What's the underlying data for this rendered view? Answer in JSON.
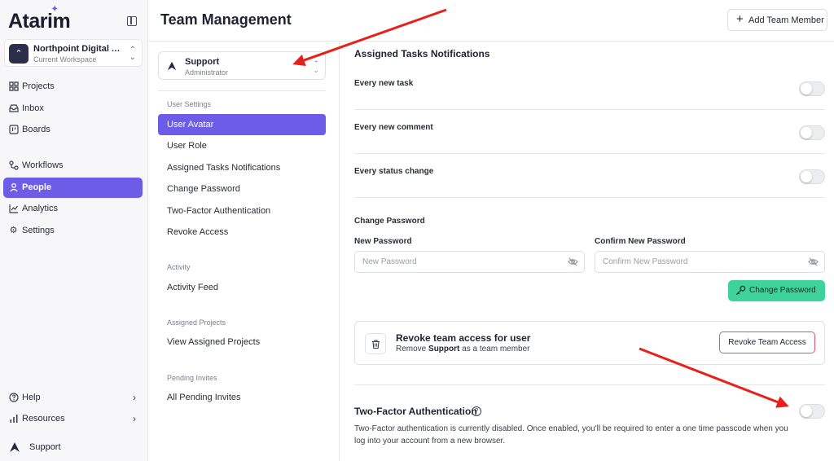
{
  "brand": {
    "name": "Atarim"
  },
  "workspace": {
    "name": "Northpoint Digital Agency",
    "subtitle": "Current Workspace"
  },
  "nav": {
    "items": [
      {
        "label": "Projects",
        "icon": "grid-icon"
      },
      {
        "label": "Inbox",
        "icon": "inbox-icon"
      },
      {
        "label": "Boards",
        "icon": "board-icon"
      },
      {
        "label": "Workflows",
        "icon": "workflow-icon"
      },
      {
        "label": "People",
        "icon": "person-icon",
        "active": true
      },
      {
        "label": "Analytics",
        "icon": "analytics-icon"
      },
      {
        "label": "Settings",
        "icon": "gear-icon"
      }
    ],
    "bottom": [
      {
        "label": "Help",
        "icon": "help-icon"
      },
      {
        "label": "Resources",
        "icon": "bars-icon"
      }
    ],
    "user": {
      "label": "Support"
    }
  },
  "page": {
    "title": "Team Management",
    "add_member_label": "Add Team Member"
  },
  "user_selector": {
    "name": "Support",
    "role": "Administrator"
  },
  "settings_nav": {
    "user_settings_heading": "User Settings",
    "user_settings": [
      "User Avatar",
      "User Role",
      "Assigned Tasks Notifications",
      "Change Password",
      "Two-Factor Authentication",
      "Revoke Access"
    ],
    "activity_heading": "Activity",
    "activity": [
      "Activity Feed"
    ],
    "projects_heading": "Assigned Projects",
    "projects": [
      "View Assigned Projects"
    ],
    "invites_heading": "Pending Invites",
    "invites": [
      "All Pending Invites"
    ]
  },
  "notifications": {
    "title": "Assigned Tasks Notifications",
    "rows": [
      {
        "label": "Every new task",
        "enabled": false
      },
      {
        "label": "Every new comment",
        "enabled": false
      },
      {
        "label": "Every status change",
        "enabled": false
      }
    ]
  },
  "change_password": {
    "title": "Change Password",
    "new_label": "New Password",
    "new_placeholder": "New Password",
    "confirm_label": "Confirm New Password",
    "confirm_placeholder": "Confirm New Password",
    "button_label": "Change Password"
  },
  "revoke": {
    "title": "Revoke team access for user",
    "desc_prefix": "Remove",
    "desc_user": "Support",
    "desc_suffix": "as a team member",
    "button_label": "Revoke Team Access"
  },
  "two_factor": {
    "title": "Two-Factor Authentication",
    "help_glyph": "?",
    "description": "Two-Factor authentication is currently disabled. Once enabled, you'll be required to enter a one time passcode when you log into your account from a new browser.",
    "enabled": false
  },
  "colors": {
    "accent": "#6c5ce7",
    "success": "#3ed39a",
    "danger": "#e2546e",
    "annotation": "#e8201c"
  }
}
